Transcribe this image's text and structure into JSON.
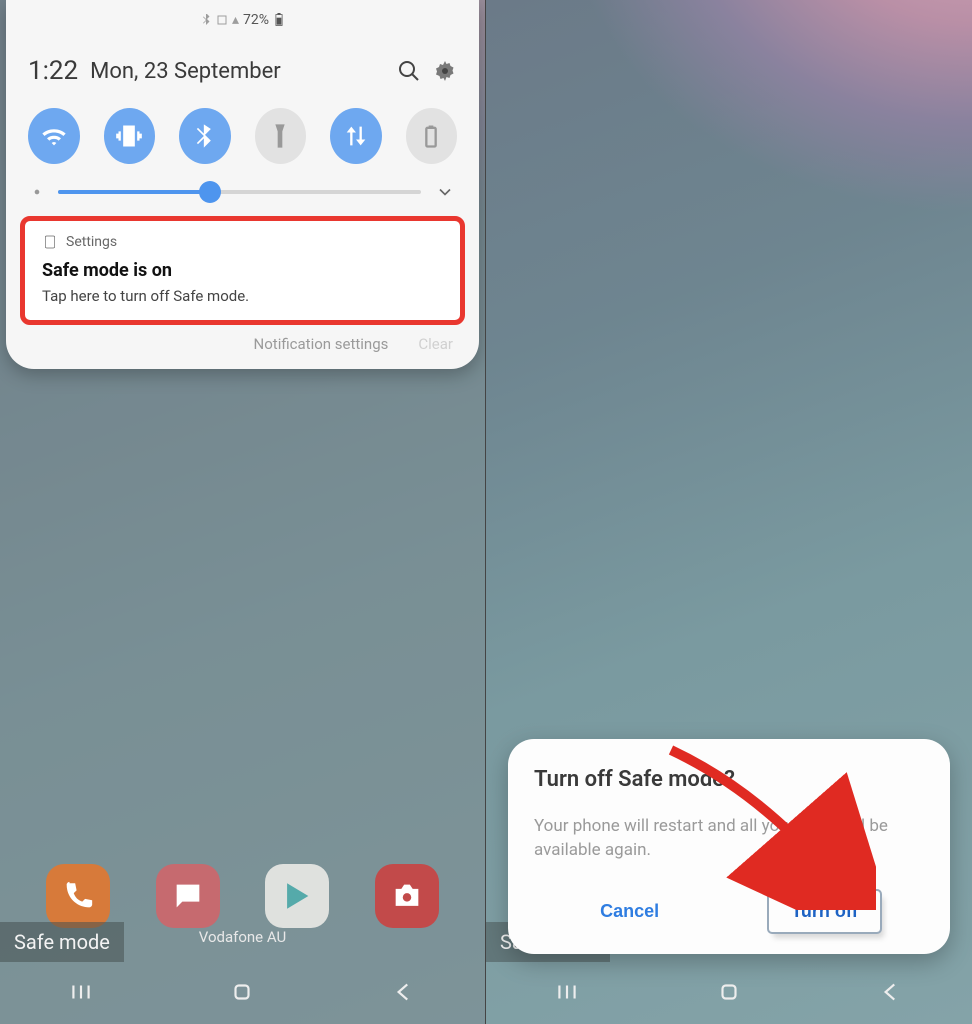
{
  "statusbar": {
    "battery_pct": "72%"
  },
  "quick_settings": {
    "time": "1:22",
    "date": "Mon, 23 September"
  },
  "notification": {
    "source": "Settings",
    "title": "Safe mode is on",
    "subtitle": "Tap here to turn off Safe mode.",
    "footer_settings": "Notification settings",
    "footer_clear": "Clear"
  },
  "home": {
    "carrier": "Vodafone AU",
    "safe_mode_badge": "Safe mode"
  },
  "dialog": {
    "title": "Turn off Safe mode?",
    "body": "Your phone will restart and all your apps will be available again.",
    "cancel": "Cancel",
    "confirm": "Turn off"
  }
}
